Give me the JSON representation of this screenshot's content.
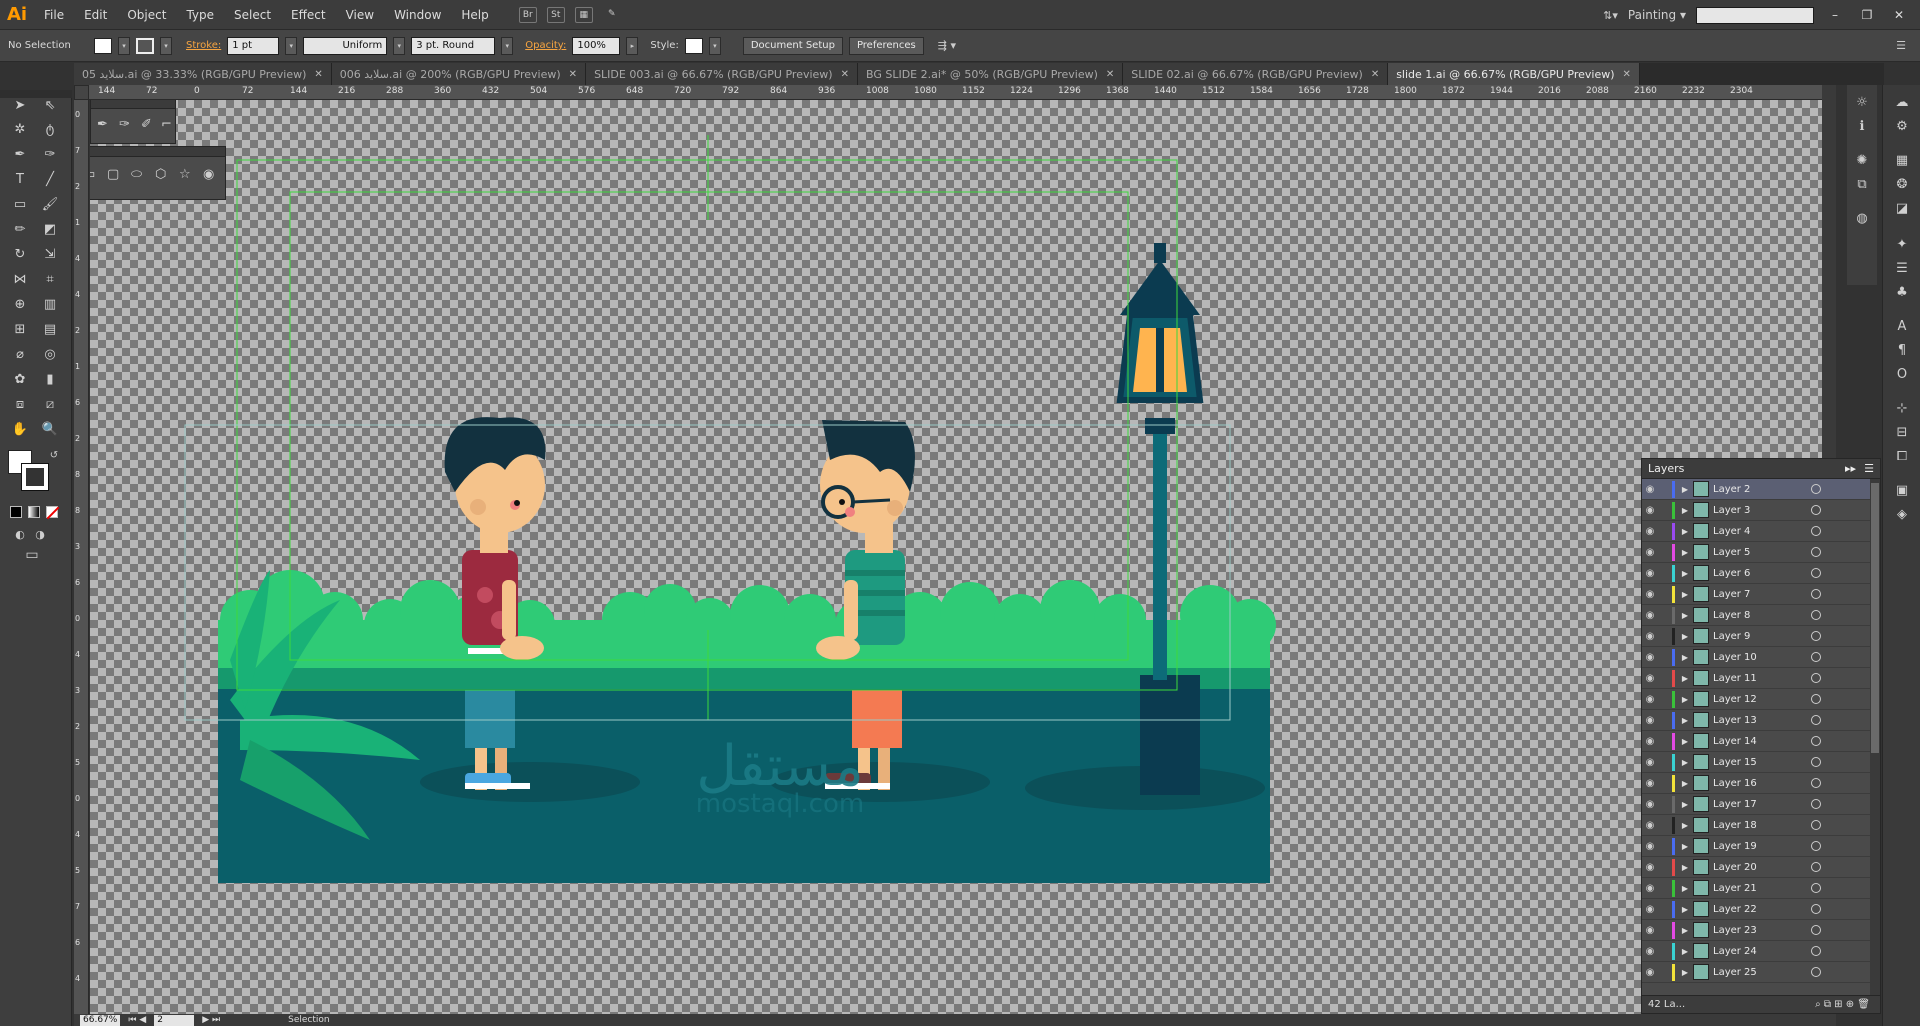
{
  "app": {
    "logo": "Ai"
  },
  "menu": [
    "File",
    "Edit",
    "Object",
    "Type",
    "Select",
    "Effect",
    "View",
    "Window",
    "Help"
  ],
  "menu_icons": [
    "Br",
    "St",
    "arrange-icon",
    "brush-icon"
  ],
  "workspace": {
    "label": "Painting ▾"
  },
  "control": {
    "selection": "No Selection",
    "stroke_label": "Stroke:",
    "stroke_value": "1 pt",
    "profile": "Uniform",
    "brush": "3 pt. Round",
    "opacity_label": "Opacity:",
    "opacity_value": "100%",
    "style_label": "Style:",
    "doc_setup": "Document Setup",
    "prefs": "Preferences"
  },
  "tabs": [
    {
      "label": "05 سلاید.ai @ 33.33% (RGB/GPU Preview)",
      "active": false
    },
    {
      "label": "006 سلاید.ai @ 200% (RGB/GPU Preview)",
      "active": false
    },
    {
      "label": "SLIDE 003.ai @ 66.67% (RGB/GPU Preview)",
      "active": false
    },
    {
      "label": "BG SLIDE 2.ai* @ 50% (RGB/GPU Preview)",
      "active": false
    },
    {
      "label": "SLIDE 02.ai @ 66.67% (RGB/GPU Preview)",
      "active": false
    },
    {
      "label": "slide 1.ai @ 66.67% (RGB/GPU Preview)",
      "active": true
    }
  ],
  "ruler_h": [
    "144",
    "72",
    "0",
    "72",
    "144",
    "216",
    "288",
    "360",
    "432",
    "504",
    "576",
    "648",
    "720",
    "792",
    "864",
    "936",
    "1008",
    "1080",
    "1152",
    "1224",
    "1296",
    "1368",
    "1440",
    "1512",
    "1584",
    "1656",
    "1728",
    "1800",
    "1872",
    "1944",
    "2016",
    "2088",
    "2160",
    "2232",
    "2304"
  ],
  "ruler_v": [
    "0",
    "7",
    "2",
    "1",
    "4",
    "4",
    "2",
    "1",
    "6",
    "2",
    "8",
    "8",
    "3",
    "6",
    "0",
    "4",
    "3",
    "2",
    "5",
    "0",
    "4",
    "5",
    "7",
    "6",
    "4"
  ],
  "status": {
    "zoom": "66.67%",
    "artboard": "2",
    "mode": "Selection"
  },
  "layers": {
    "title": "Layers",
    "count": "42 La...",
    "items": [
      {
        "name": "Layer 2",
        "color": "#4a6cf0",
        "selected": true
      },
      {
        "name": "Layer 3",
        "color": "#3ac13a"
      },
      {
        "name": "Layer 4",
        "color": "#9a4af0"
      },
      {
        "name": "Layer 5",
        "color": "#e44ae4"
      },
      {
        "name": "Layer 6",
        "color": "#3ad2d2"
      },
      {
        "name": "Layer 7",
        "color": "#f2e23a"
      },
      {
        "name": "Layer 8",
        "color": "#6a6a6a"
      },
      {
        "name": "Layer 9",
        "color": "#222222"
      },
      {
        "name": "Layer 10",
        "color": "#4a6cf0"
      },
      {
        "name": "Layer 11",
        "color": "#e24a4a"
      },
      {
        "name": "Layer 12",
        "color": "#3ac13a"
      },
      {
        "name": "Layer 13",
        "color": "#4a6cf0"
      },
      {
        "name": "Layer 14",
        "color": "#e44ae4"
      },
      {
        "name": "Layer 15",
        "color": "#3ad2d2"
      },
      {
        "name": "Layer 16",
        "color": "#f2e23a"
      },
      {
        "name": "Layer 17",
        "color": "#6a6a6a"
      },
      {
        "name": "Layer 18",
        "color": "#222222"
      },
      {
        "name": "Layer 19",
        "color": "#4a6cf0"
      },
      {
        "name": "Layer 20",
        "color": "#e24a4a"
      },
      {
        "name": "Layer 21",
        "color": "#3ac13a"
      },
      {
        "name": "Layer 22",
        "color": "#4a6cf0"
      },
      {
        "name": "Layer 23",
        "color": "#e44ae4"
      },
      {
        "name": "Layer 24",
        "color": "#3ad2d2"
      },
      {
        "name": "Layer 25",
        "color": "#f2e23a"
      }
    ]
  },
  "watermark": {
    "arabic": "مستقل",
    "latin": "mostaql.com"
  }
}
